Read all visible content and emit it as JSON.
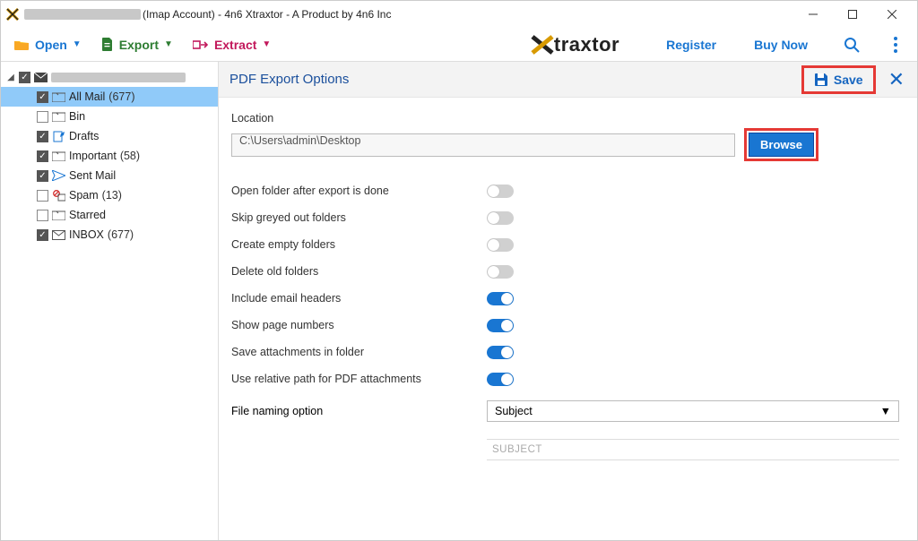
{
  "window": {
    "title_suffix": "(Imap Account) - 4n6 Xtraxtor - A Product by 4n6 Inc"
  },
  "toolbar": {
    "open": "Open",
    "export": "Export",
    "extract": "Extract",
    "brand": "traxtor",
    "register": "Register",
    "buy": "Buy Now"
  },
  "tree": {
    "items": [
      {
        "label": "All Mail",
        "count": "(677)",
        "checked": true,
        "selected": true,
        "icon": "folder"
      },
      {
        "label": "Bin",
        "count": "",
        "checked": false,
        "icon": "folder"
      },
      {
        "label": "Drafts",
        "count": "",
        "checked": true,
        "icon": "draft"
      },
      {
        "label": "Important",
        "count": "(58)",
        "checked": true,
        "icon": "folder"
      },
      {
        "label": "Sent Mail",
        "count": "",
        "checked": true,
        "icon": "sent"
      },
      {
        "label": "Spam",
        "count": "(13)",
        "checked": false,
        "icon": "spam"
      },
      {
        "label": "Starred",
        "count": "",
        "checked": false,
        "icon": "folder"
      },
      {
        "label": "INBOX",
        "count": "(677)",
        "checked": true,
        "icon": "inbox"
      }
    ]
  },
  "panel": {
    "title": "PDF Export Options",
    "save": "Save",
    "location_label": "Location",
    "location_value": "C:\\Users\\admin\\Desktop",
    "browse": "Browse",
    "options": [
      {
        "label": "Open folder after export is done",
        "on": false
      },
      {
        "label": "Skip greyed out folders",
        "on": false
      },
      {
        "label": "Create empty folders",
        "on": false
      },
      {
        "label": "Delete old folders",
        "on": false
      },
      {
        "label": "Include email headers",
        "on": true
      },
      {
        "label": "Show page numbers",
        "on": true
      },
      {
        "label": "Save attachments in folder",
        "on": true
      },
      {
        "label": "Use relative path for PDF attachments",
        "on": true
      }
    ],
    "naming_label": "File naming option",
    "naming_value": "Subject",
    "subject_placeholder": "SUBJECT"
  }
}
